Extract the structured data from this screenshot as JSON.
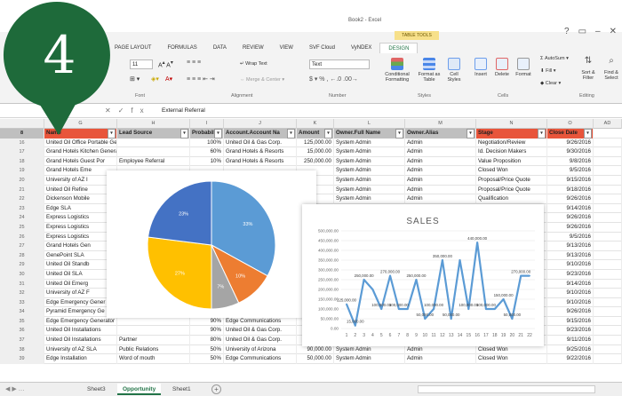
{
  "app": {
    "title": "Book2 - Excel",
    "table_tools": "TABLE TOOLS",
    "badge_number": "4"
  },
  "ribbon": {
    "tabs": [
      "PAGE LAYOUT",
      "FORMULAS",
      "DATA",
      "REVIEW",
      "VIEW",
      "SVF Cloud",
      "VyNDEX",
      "DESIGN"
    ],
    "font_size": "11",
    "number_format": "Text",
    "buttons": {
      "wrap_text": "Wrap Text",
      "merge_center": "Merge & Center",
      "conditional_formatting": "Conditional Formatting",
      "format_as_table": "Format as Table",
      "cell_styles": "Cell Styles",
      "insert": "Insert",
      "delete": "Delete",
      "format": "Format",
      "autosum": "AutoSum",
      "fill": "Fill",
      "clear": "Clear",
      "sort_filter": "Sort & Filter",
      "find_select": "Find & Select"
    },
    "groups": {
      "font": "Font",
      "alignment": "Alignment",
      "number": "Number",
      "styles": "Styles",
      "cells": "Cells",
      "editing": "Editing"
    }
  },
  "formula_bar": {
    "value": "External Referral"
  },
  "columns": [
    "G",
    "H",
    "I",
    "J",
    "K",
    "L",
    "M",
    "N",
    "O",
    "P",
    "Q",
    "AD"
  ],
  "table": {
    "headers": [
      "Name",
      "Lead Source",
      "Probabili",
      "Account.Account Na",
      "Amount",
      "Owner.Full Name",
      "Owner.Alias",
      "Stage",
      "Close Date"
    ],
    "rows": [
      {
        "n": "16",
        "c": [
          "United Oil Office Portable Generators",
          "",
          "100%",
          "United Oil & Gas Corp.",
          "125,000.00",
          "System Admin",
          "Admin",
          "Negotiation/Review",
          "9/26/2016"
        ]
      },
      {
        "n": "17",
        "c": [
          "Grand Hotels Kitchen Generator",
          "",
          "60%",
          "Grand Hotels & Resorts",
          "15,000.00",
          "System Admin",
          "Admin",
          "Id. Decision Makers",
          "9/30/2016"
        ]
      },
      {
        "n": "18",
        "c": [
          "Grand Hotels Guest Por",
          "Employee Referral",
          "10%",
          "Grand Hotels & Resorts",
          "250,000.00",
          "System Admin",
          "Admin",
          "Value Proposition",
          "9/8/2016"
        ]
      },
      {
        "n": "19",
        "c": [
          "Grand Hotels Eme",
          "",
          "",
          "",
          "",
          "System Admin",
          "Admin",
          "Closed Won",
          "9/5/2016"
        ]
      },
      {
        "n": "20",
        "c": [
          "University of AZ I",
          "",
          "",
          "",
          "",
          "System Admin",
          "Admin",
          "Proposal/Price Quote",
          "9/15/2016"
        ]
      },
      {
        "n": "21",
        "c": [
          "United Oil Refine",
          "",
          "",
          "",
          "",
          "System Admin",
          "Admin",
          "Proposal/Price Quote",
          "9/18/2016"
        ]
      },
      {
        "n": "22",
        "c": [
          "Dickenson Mobile",
          "",
          "",
          "",
          "",
          "System Admin",
          "Admin",
          "Qualification",
          "9/26/2016"
        ]
      },
      {
        "n": "23",
        "c": [
          "Edge SLA",
          "",
          "",
          "",
          "",
          "",
          "",
          "",
          "9/14/2016"
        ]
      },
      {
        "n": "24",
        "c": [
          "Express Logistics",
          "",
          "",
          "",
          "",
          "",
          "",
          "",
          "9/26/2016"
        ]
      },
      {
        "n": "25",
        "c": [
          "Express Logistics",
          "",
          "",
          "",
          "",
          "",
          "",
          "",
          "9/26/2016"
        ]
      },
      {
        "n": "26",
        "c": [
          "Express Logistics",
          "",
          "",
          "",
          "",
          "",
          "",
          "",
          "9/5/2016"
        ]
      },
      {
        "n": "27",
        "c": [
          "Grand Hotels Gen",
          "",
          "",
          "",
          "",
          "",
          "",
          "",
          "9/13/2016"
        ]
      },
      {
        "n": "28",
        "c": [
          "GenePoint SLA",
          "",
          "",
          "",
          "",
          "",
          "",
          "",
          "9/13/2016"
        ]
      },
      {
        "n": "29",
        "c": [
          "United Oil Standb",
          "",
          "",
          "",
          "",
          "",
          "",
          "",
          "9/10/2016"
        ]
      },
      {
        "n": "30",
        "c": [
          "United Oil SLA",
          "",
          "",
          "",
          "",
          "",
          "",
          "",
          "9/23/2016"
        ]
      },
      {
        "n": "31",
        "c": [
          "United Oil Emerg",
          "",
          "",
          "",
          "",
          "",
          "",
          "",
          "9/14/2016"
        ]
      },
      {
        "n": "32",
        "c": [
          "University of AZ F",
          "",
          "",
          "",
          "",
          "",
          "",
          "",
          "9/10/2016"
        ]
      },
      {
        "n": "33",
        "c": [
          "Edge Emergency Gener",
          "Word of mouth",
          "70%",
          "Edge Communications",
          "",
          "",
          "",
          "",
          "9/10/2016"
        ]
      },
      {
        "n": "34",
        "c": [
          "Pyramid Emergency Ge",
          "Phone Inquiry",
          "70%",
          "Pyramid Construction I",
          "",
          "",
          "",
          "",
          "9/26/2016"
        ]
      },
      {
        "n": "35",
        "c": [
          "Edge Emergency Generator",
          "",
          "90%",
          "Edge Communications",
          "",
          "",
          "",
          "",
          "9/15/2016"
        ]
      },
      {
        "n": "36",
        "c": [
          "United Oil Installations",
          "",
          "90%",
          "United Oil & Gas Corp.",
          "",
          "",
          "",
          "",
          "9/23/2016"
        ]
      },
      {
        "n": "37",
        "c": [
          "United Oil Installations",
          "Partner",
          "80%",
          "United Oil & Gas Corp.",
          "270,000.00",
          "System Admin",
          "Admin",
          "Closed Won",
          "9/11/2016"
        ]
      },
      {
        "n": "38",
        "c": [
          "University of AZ SLA",
          "Public Relations",
          "50%",
          "University of Arizona",
          "90,000.00",
          "System Admin",
          "Admin",
          "Closed Won",
          "9/25/2016"
        ]
      },
      {
        "n": "39",
        "c": [
          "Edge Installation",
          "Word of mouth",
          "50%",
          "Edge Communications",
          "50,000.00",
          "System Admin",
          "Admin",
          "Closed Won",
          "9/22/2016"
        ]
      }
    ]
  },
  "sheets": [
    "Sheet3",
    "Opportunity",
    "Sheet1"
  ],
  "colors": {
    "accent": "#217346",
    "badge": "#1e6a3a",
    "header_red": "#e8553b"
  },
  "chart_data": [
    {
      "type": "pie",
      "values": [
        33,
        10,
        7,
        27,
        23
      ],
      "labels": [
        "33%",
        "10%",
        "7%",
        "27%",
        "23%"
      ],
      "colors": [
        "#5b9bd5",
        "#ed7d31",
        "#a5a5a5",
        "#ffc000",
        "#4472c4"
      ]
    },
    {
      "type": "line",
      "title": "SALES",
      "x": [
        1,
        2,
        3,
        4,
        5,
        6,
        7,
        8,
        9,
        10,
        11,
        12,
        13,
        14,
        15,
        16,
        17,
        18,
        19,
        20,
        21,
        22
      ],
      "y": [
        125000,
        15000,
        250000,
        200000,
        100000,
        270000,
        100000,
        100000,
        250000,
        50000,
        100000,
        350000,
        50000,
        350000,
        100000,
        440000,
        100000,
        100000,
        150000,
        50000,
        270000,
        270000
      ],
      "data_labels": [
        "125,000.00",
        "15,000.00",
        "250,000.00",
        "",
        "100,000.00",
        "270,000.00",
        "100,000.00",
        "",
        "250,000.00",
        "50,000.00",
        "100,000.00",
        "350,000.00",
        "50,000.00",
        "",
        "100,000.00",
        "440,000.00",
        "100,000.00",
        "",
        "150,000.00",
        "50,000.00",
        "270,000.00",
        ""
      ],
      "ylim": [
        0,
        500000
      ],
      "yticks": [
        "500,000.00",
        "450,000.00",
        "400,000.00",
        "350,000.00",
        "300,000.00",
        "250,000.00",
        "200,000.00",
        "150,000.00",
        "100,000.00",
        "50,000.00",
        "0.00"
      ],
      "color": "#5b9bd5",
      "grid": true
    }
  ]
}
